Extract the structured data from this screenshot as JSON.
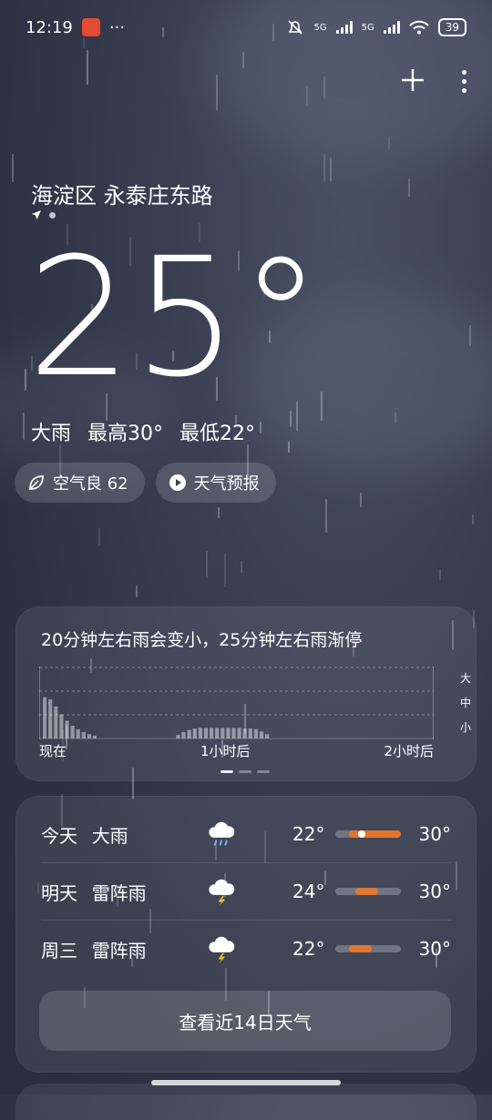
{
  "status_bar": {
    "time": "12:19",
    "more": "···",
    "net1": "5G",
    "net2": "5G",
    "battery": "39"
  },
  "header": {
    "location": "海淀区 永泰庄东路"
  },
  "current": {
    "temperature": "25°",
    "condition": "大雨",
    "high": "最高30°",
    "low": "最低22°"
  },
  "pills": {
    "air": "空气良 62",
    "forecast": "天气预报"
  },
  "precip": {
    "title": "20分钟左右雨会变小，25分钟左右雨渐停",
    "levels": [
      "大",
      "中",
      "小"
    ],
    "time_labels": [
      "现在",
      "1小时后",
      "2小时后"
    ]
  },
  "chart_data": {
    "type": "bar",
    "values": [
      0.58,
      0.55,
      0.45,
      0.34,
      0.25,
      0.18,
      0.13,
      0.09,
      0.06,
      0.04,
      0.0,
      0.0,
      0.0,
      0.0,
      0.0,
      0.0,
      0.0,
      0.0,
      0.0,
      0.0,
      0.0,
      0.0,
      0.0,
      0.0,
      0.05,
      0.09,
      0.12,
      0.14,
      0.15,
      0.15,
      0.15,
      0.15,
      0.15,
      0.15,
      0.15,
      0.15,
      0.14,
      0.14,
      0.13,
      0.1,
      0.06
    ],
    "ylabels": [
      "大",
      "中",
      "小"
    ],
    "xlabels": [
      "现在",
      "1小时后",
      "2小时后"
    ]
  },
  "forecast": [
    {
      "day": "今天",
      "cond": "大雨",
      "icon": "heavy-rain-icon",
      "lo": "22°",
      "hi": "30°",
      "range": [
        0.2,
        1.0
      ],
      "now": 0.4
    },
    {
      "day": "明天",
      "cond": "雷阵雨",
      "icon": "thunderstorm-icon",
      "lo": "24°",
      "hi": "30°",
      "range": [
        0.3,
        0.65
      ]
    },
    {
      "day": "周三",
      "cond": "雷阵雨",
      "icon": "thunderstorm-icon",
      "lo": "22°",
      "hi": "30°",
      "range": [
        0.2,
        0.55
      ]
    }
  ],
  "more_button": "查看近14日天气",
  "colors": {
    "accent": "#e0772e",
    "background": "#2d3243"
  }
}
